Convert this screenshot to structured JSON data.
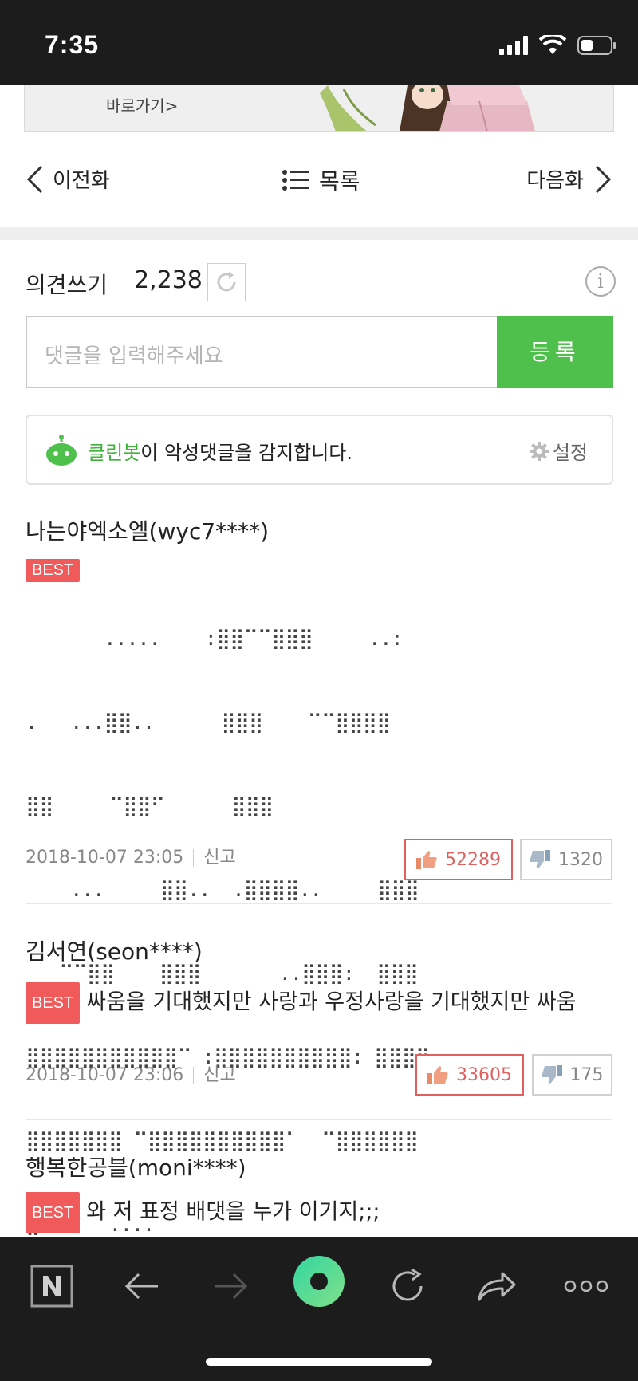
{
  "status_bar": {
    "time": "7:35"
  },
  "banner": {
    "link_label": "바로가기>"
  },
  "episode_nav": {
    "prev_label": "이전화",
    "list_label": "목록",
    "next_label": "다음화"
  },
  "comments_header": {
    "title": "의견쓰기",
    "count": "2,238"
  },
  "comment_input": {
    "placeholder": "댓글을 입력해주세요",
    "submit_label": "등록"
  },
  "cleanbot": {
    "name": "클린봇",
    "message": "이 악성댓글을 감지합니다.",
    "settings_label": "설정"
  },
  "comments": [
    {
      "nickname": "나는야엑소엘(wyc7****)",
      "badge": "BEST",
      "body_art": [
        "       .....    :⣿⣿⠉⠉⣿⣿⣿     ..:",
        ".   ...⣿⣿..      ⣿⣿⣿    ⠉⠉⣿⣿⣿⣿",
        "⣿⣿     ⠉⣿⣿⠋      ⣿⣿⣿",
        "    ...     ⣿⣿..  .⣿⣿⣿⣿..     ⣿⣿⣿",
        "   ⠉⠉⣿⣿    ⣿⣿⣿       ..⣿⣿⣿:  ⣿⣿⣿",
        "⣿⣿⣿⣿⣿⣿⣿⣿⣿⣿⣿⠉ :⣿⣿⣿⣿⣿⣿⣿⣿⣿⣿: ⣿⣿⣿⣿",
        "⣿⣿⣿⣿⣿⣿⣿ ⠉⣿⣿⣿⣿⣿⣿⣿⣿⣿⣿⠁  ⠉⣿⣿⣿⣿⣿⣿",
        "⣿⠋     ....                          "
      ],
      "timestamp": "2018-10-07 23:05",
      "report_label": "신고",
      "likes": "52289",
      "dislikes": "1320"
    },
    {
      "nickname": "김서연(seon****)",
      "badge": "BEST",
      "body": "싸움을 기대했지만 사랑과 우정사랑을 기대했지만 싸움",
      "timestamp": "2018-10-07 23:06",
      "report_label": "신고",
      "likes": "33605",
      "dislikes": "175"
    },
    {
      "nickname": "행복한공블(moni****)",
      "badge": "BEST",
      "body": "와 저 표정 배댓을 누가 이기지;;;"
    }
  ]
}
